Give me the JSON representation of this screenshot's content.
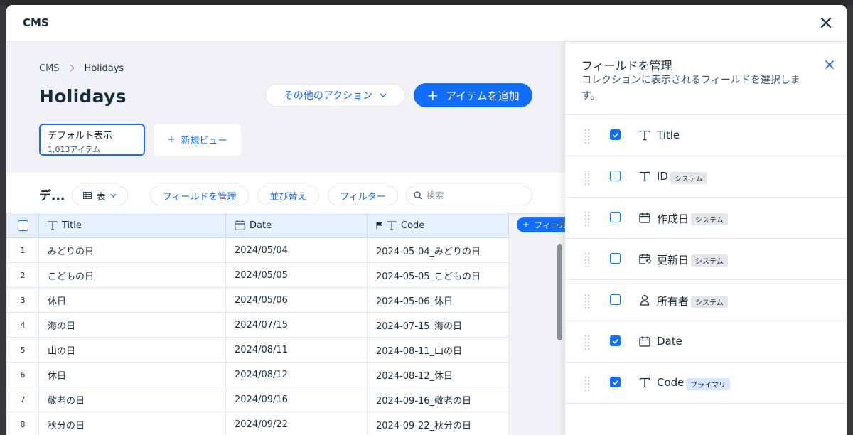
{
  "modal": {
    "title": "CMS"
  },
  "breadcrumb": {
    "root": "CMS",
    "current": "Holidays"
  },
  "page": {
    "title": "Holidays"
  },
  "actions": {
    "more_label": "その他のアクション",
    "add_item_label": "アイテムを追加"
  },
  "views": {
    "default": {
      "name": "デフォルト表示",
      "count": "1,013アイテム"
    },
    "new_label": "新規ビュー"
  },
  "toolbar": {
    "title": "デ...",
    "table_label": "表",
    "manage_fields_label": "フィールドを管理",
    "sort_label": "並び替え",
    "filter_label": "フィルター",
    "search_placeholder": "検索"
  },
  "table": {
    "columns": [
      "Title",
      "Date",
      "Code"
    ],
    "rows": [
      {
        "num": "1",
        "title": "みどりの日",
        "date": "2024/05/04",
        "code": "2024-05-04_みどりの日"
      },
      {
        "num": "2",
        "title": "こどもの日",
        "date": "2024/05/05",
        "code": "2024-05-05_こどもの日"
      },
      {
        "num": "3",
        "title": "休日",
        "date": "2024/05/06",
        "code": "2024-05-06_休日"
      },
      {
        "num": "4",
        "title": "海の日",
        "date": "2024/07/15",
        "code": "2024-07-15_海の日"
      },
      {
        "num": "5",
        "title": "山の日",
        "date": "2024/08/11",
        "code": "2024-08-11_山の日"
      },
      {
        "num": "6",
        "title": "休日",
        "date": "2024/08/12",
        "code": "2024-08-12_休日"
      },
      {
        "num": "7",
        "title": "敬老の日",
        "date": "2024/09/16",
        "code": "2024-09-16_敬老の日"
      },
      {
        "num": "8",
        "title": "秋分の日",
        "date": "2024/09/22",
        "code": "2024-09-22_秋分の日"
      }
    ],
    "add_field_label": "フィール"
  },
  "panel": {
    "title": "フィールドを管理",
    "description": "コレクションに表示されるフィールドを選択します。",
    "fields": [
      {
        "name": "Title",
        "icon": "text-icon",
        "checked": true,
        "badge": ""
      },
      {
        "name": "ID",
        "icon": "text-icon",
        "checked": false,
        "badge": "システム"
      },
      {
        "name": "作成日",
        "icon": "calendar-icon",
        "checked": false,
        "badge": "システム"
      },
      {
        "name": "更新日",
        "icon": "calendar-refresh-icon",
        "checked": false,
        "badge": "システム"
      },
      {
        "name": "所有者",
        "icon": "person-icon",
        "checked": false,
        "badge": "システム"
      },
      {
        "name": "Date",
        "icon": "calendar-icon",
        "checked": true,
        "badge": ""
      },
      {
        "name": "Code",
        "icon": "text-icon",
        "checked": true,
        "badge": "プライマリ"
      }
    ]
  },
  "colors": {
    "accent": "#116dff",
    "text": "#162d3d",
    "header_bg": "#e7f0ff"
  }
}
